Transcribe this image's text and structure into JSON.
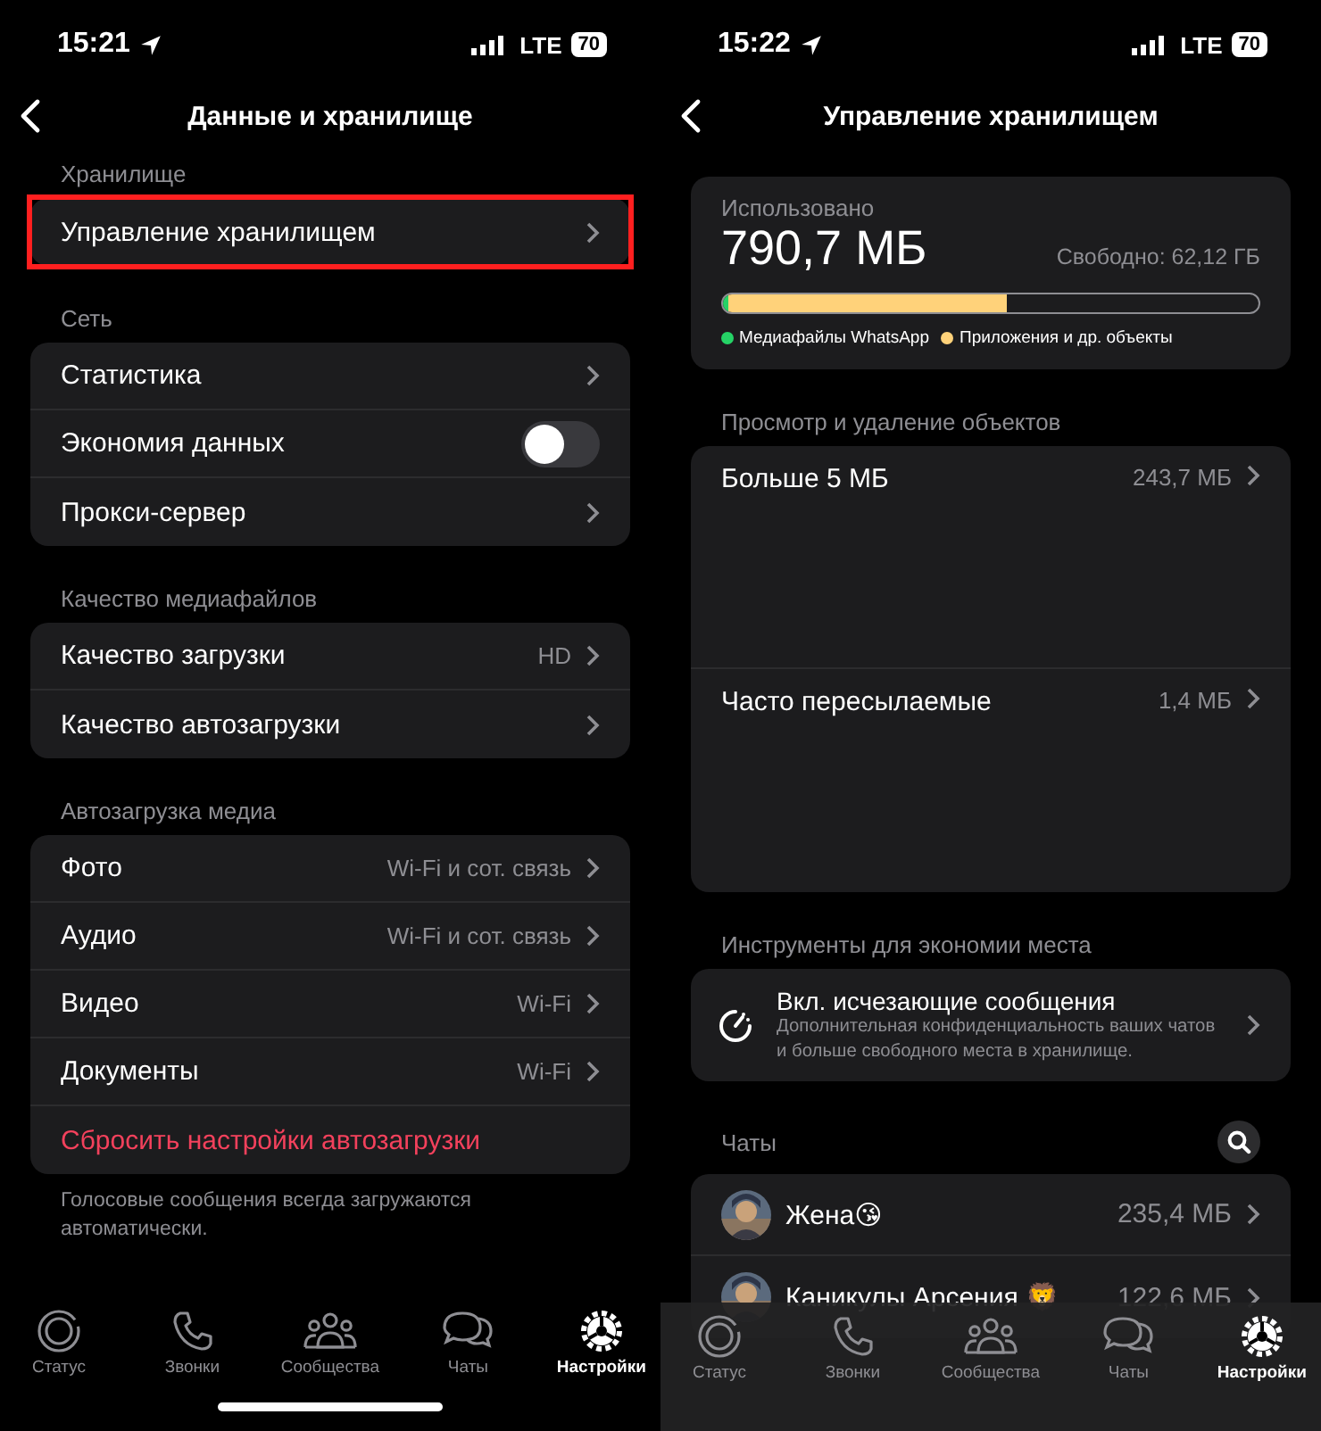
{
  "panes": [
    {
      "time": "15:21",
      "network": "LTE",
      "battery": "70",
      "title": "Данные и хранилище",
      "sections": [
        {
          "header": "Хранилище",
          "rows": [
            {
              "kind": "link",
              "label": "Управление хранилищем",
              "highlighted": true
            }
          ]
        },
        {
          "header": "Сеть",
          "rows": [
            {
              "kind": "link",
              "label": "Статистика",
              "highlighted": false
            },
            {
              "kind": "toggle",
              "label": "Экономия данных",
              "on": false
            },
            {
              "kind": "link",
              "label": "Прокси-сервер",
              "highlighted": false
            }
          ]
        },
        {
          "header": "Качество медиафайлов",
          "rows": [
            {
              "kind": "link",
              "label": "Качество загрузки",
              "value": "HD",
              "highlighted": false
            },
            {
              "kind": "link",
              "label": "Качество автозагрузки",
              "highlighted": false
            }
          ]
        },
        {
          "header": "Автозагрузка медиа",
          "rows": [
            {
              "kind": "link",
              "label": "Фото",
              "value": "Wi-Fi и сот. связь",
              "highlighted": false
            },
            {
              "kind": "link",
              "label": "Аудио",
              "value": "Wi-Fi и сот. связь",
              "highlighted": false
            },
            {
              "kind": "link",
              "label": "Видео",
              "value": "Wi-Fi",
              "highlighted": false
            },
            {
              "kind": "link",
              "label": "Документы",
              "value": "Wi-Fi",
              "highlighted": false
            },
            {
              "kind": "action",
              "label": "Сбросить настройки автозагрузки"
            }
          ]
        }
      ],
      "footnote": "Голосовые сообщения всегда загружаются автоматически.",
      "tabs": [
        {
          "label": "Статус",
          "selected": false
        },
        {
          "label": "Звонки",
          "selected": false
        },
        {
          "label": "Сообщества",
          "selected": false
        },
        {
          "label": "Чаты",
          "selected": false
        },
        {
          "label": "Настройки",
          "selected": true
        }
      ],
      "home_indicator": true
    },
    {
      "time": "15:22",
      "network": "LTE",
      "battery": "70",
      "title": "Управление хранилищем",
      "usage": {
        "label": "Использовано",
        "used": "790,7 МБ",
        "free": "Свободно: 62,12 ГБ",
        "segments": [
          {
            "color": "#25d366",
            "level": 0.01
          },
          {
            "color": "#ffd27a",
            "level": 0.52
          }
        ],
        "legend": [
          {
            "label": "Медиафайлы WhatsApp",
            "color": "#25d366"
          },
          {
            "label": "Приложения и др. объекты",
            "color": "#ffd27a"
          }
        ]
      },
      "sections": [
        {
          "header": "Просмотр и удаление объектов",
          "rows": [
            {
              "kind": "large",
              "label": "Больше 5 МБ",
              "value": "243,7 МБ"
            },
            {
              "kind": "large",
              "label": "Часто пересылаемые",
              "value": "1,4 МБ"
            }
          ]
        },
        {
          "header": "Инструменты для экономии места",
          "rows": [
            {
              "kind": "tool",
              "label": "Вкл. исчезающие сообщения",
              "description": "Дополнительная конфиденциальность ваших чатов и больше свободного места в хранилище."
            }
          ]
        },
        {
          "header": "Чаты",
          "search": true,
          "rows": [
            {
              "kind": "chat",
              "label": "Жена😘",
              "value": "235,4 МБ"
            },
            {
              "kind": "chat",
              "label": "Каникулы Арсения 🦁",
              "value": "122,6 МБ"
            }
          ]
        }
      ],
      "tabs": [
        {
          "label": "Статус",
          "selected": false
        },
        {
          "label": "Звонки",
          "selected": false
        },
        {
          "label": "Сообщества",
          "selected": false
        },
        {
          "label": "Чаты",
          "selected": false
        },
        {
          "label": "Настройки",
          "selected": true
        }
      ],
      "home_indicator": false
    }
  ]
}
